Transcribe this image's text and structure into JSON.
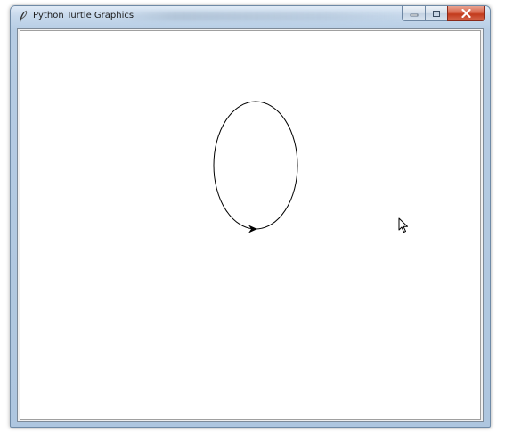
{
  "window": {
    "title": "Python Turtle Graphics",
    "icon": "feather-icon",
    "buttons": {
      "minimize": "minimize-icon",
      "maximize": "maximize-icon",
      "close": "close-icon"
    }
  },
  "canvas": {
    "background": "#ffffff",
    "pen_color": "#000000",
    "shape": "ellipse",
    "turtle_icon": "arrow-turtle-icon",
    "turtle_heading": "east"
  },
  "cursor": {
    "icon": "mouse-pointer-icon"
  },
  "colors": {
    "close_button": "#c9442a",
    "titlebar": "#c7d9ec"
  }
}
